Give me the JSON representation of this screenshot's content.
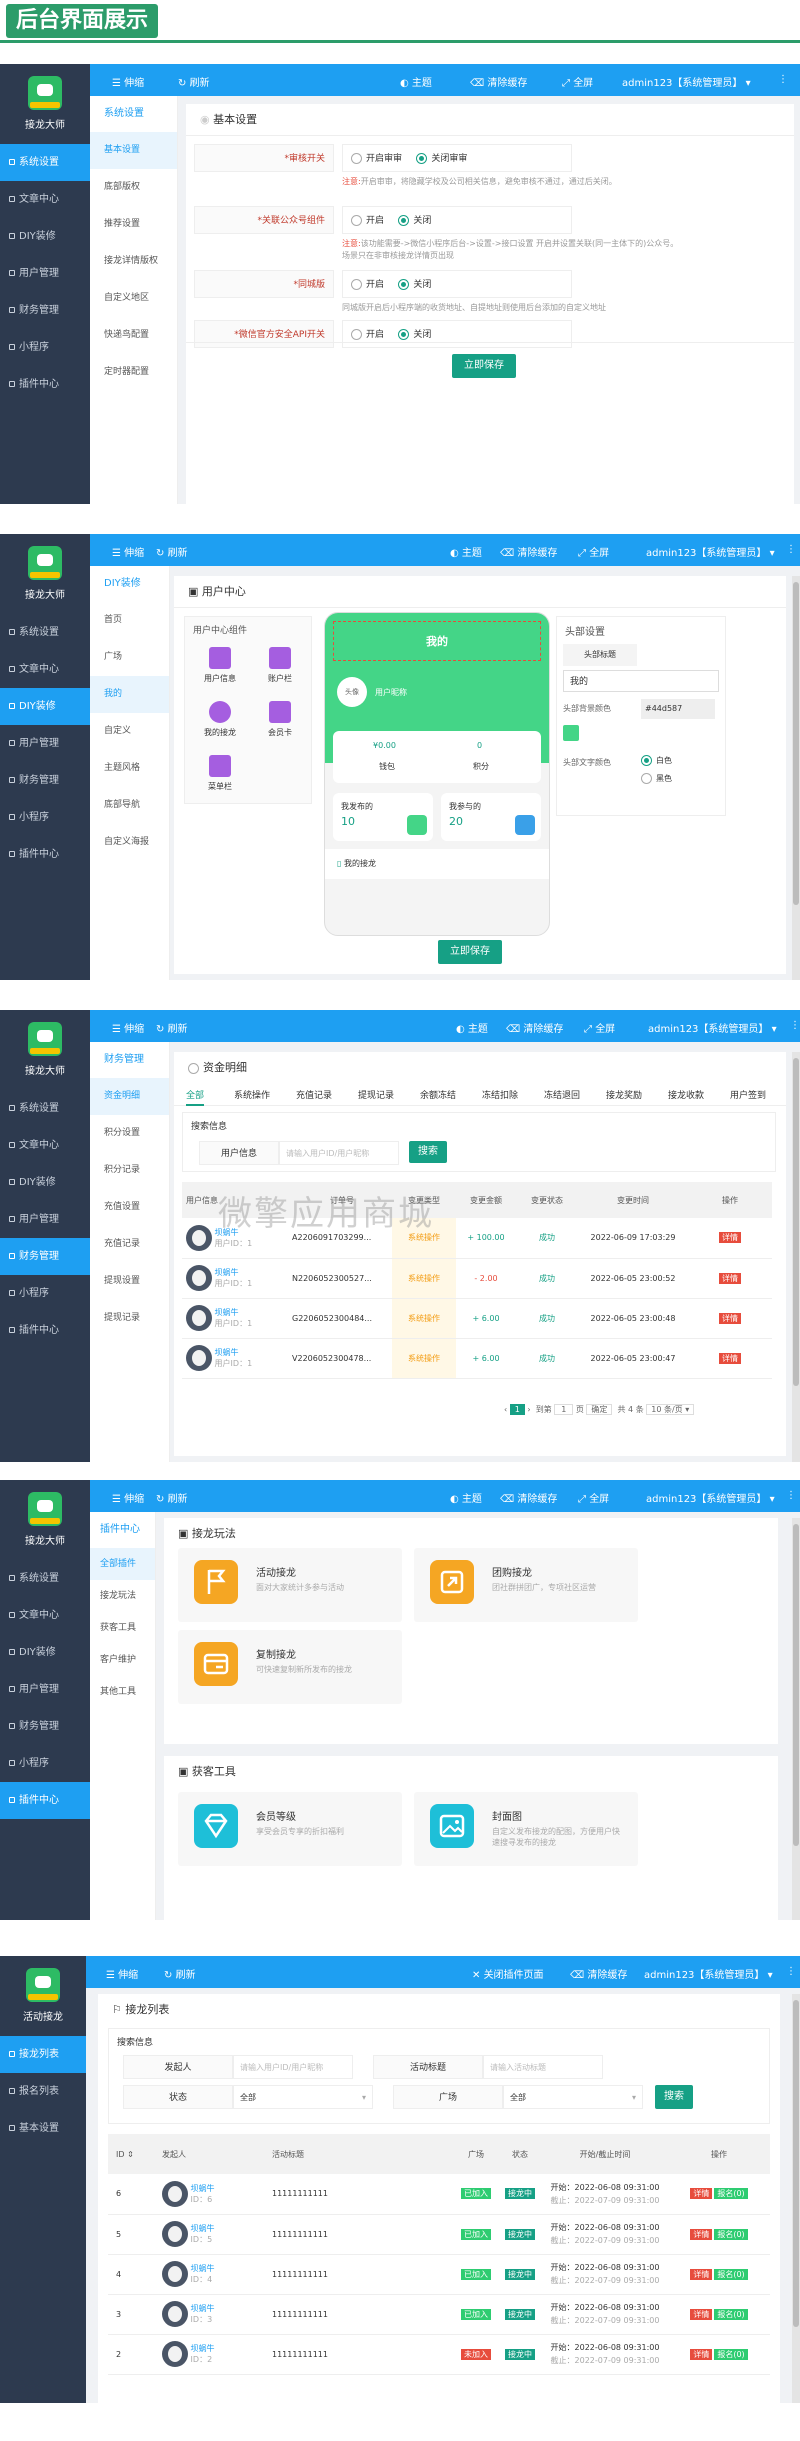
{
  "hero_title": "后台界面展示",
  "brand": "接龙大师",
  "brand2": "活动接龙",
  "topbar": {
    "collapse": "伸缩",
    "refresh": "刷新",
    "theme": "主题",
    "clear_cache": "清除缓存",
    "fullscreen": "全屏",
    "user": "admin123【系统管理员】",
    "close_plugin": "关闭插件页面"
  },
  "main_menu": [
    "系统设置",
    "文章中心",
    "DIY装修",
    "用户管理",
    "财务管理",
    "小程序",
    "插件中心"
  ],
  "s1": {
    "sub_head": "系统设置",
    "sub_items": [
      "基本设置",
      "底部版权",
      "推荐设置",
      "接龙详情版权",
      "自定义地区",
      "快递鸟配置",
      "定时器配置"
    ],
    "panel_title": "基本设置",
    "rows": [
      {
        "label": "*审核开关",
        "opt1": "开启审审",
        "opt2": "关闭审审",
        "note_label": "注意:",
        "note": "开启审审，将隐藏学校及公司相关信息，避免审核不通过，通过后关闭。"
      },
      {
        "label": "*关联公众号组件",
        "opt1": "开启",
        "opt2": "关闭",
        "note_label": "注意:",
        "note": "该功能需要->微信小程序后台->设置->接口设置 开启并设置关联(同一主体下的)公众号。",
        "note2": "场景只在非审核接龙详情页出现"
      },
      {
        "label": "*同城版",
        "opt1": "开启",
        "opt2": "关闭",
        "note": "同城版开启后小程序端的收货地址、自提地址则使用后台添加的自定义地址"
      },
      {
        "label": "*微信官方安全API开关",
        "opt1": "开启",
        "opt2": "关闭"
      }
    ],
    "save": "立即保存"
  },
  "s2": {
    "sub_head": "DIY装修",
    "sub_items": [
      "首页",
      "广场",
      "我的",
      "自定义",
      "主题风格",
      "底部导航",
      "自定义海报"
    ],
    "panel_title": "用户中心",
    "widgets_title": "用户中心组件",
    "widgets": [
      "用户信息",
      "账户栏",
      "我的接龙",
      "会员卡",
      "菜单栏"
    ],
    "phone": {
      "header": "我的",
      "avatar": "头像",
      "nickname": "用户昵称",
      "wallet_val": "¥0.00",
      "wallet": "钱包",
      "points_val": "0",
      "points": "积分",
      "pub": "我发布的",
      "pub_val": "10",
      "join": "我参与的",
      "join_val": "20",
      "my_jl": "我的接龙"
    },
    "cfg": {
      "title": "头部设置",
      "tab": "头部标题",
      "title_val": "我的",
      "bg_label": "头部背景颜色",
      "bg_val": "#44d587",
      "color_label": "头部文字颜色",
      "white": "白色",
      "black": "黑色"
    },
    "save": "立即保存"
  },
  "s3": {
    "sub_head": "财务管理",
    "sub_items": [
      "资金明细",
      "积分设置",
      "积分记录",
      "充值设置",
      "充值记录",
      "提现设置",
      "提现记录"
    ],
    "panel_title": "资金明细",
    "tabs": [
      "全部",
      "系统操作",
      "充值记录",
      "提现记录",
      "余额冻结",
      "冻结扣除",
      "冻结退回",
      "接龙奖励",
      "接龙收款",
      "用户签到"
    ],
    "search_title": "搜索信息",
    "user_label": "用户信息",
    "user_ph": "请输入用户ID/用户昵称",
    "search_btn": "搜索",
    "cols": [
      "用户信息",
      "订单号",
      "变更类型",
      "变更金额",
      "变更状态",
      "变更时间",
      "操作"
    ],
    "rows": [
      {
        "name": "坝蜗牛",
        "uid": "用户ID：1",
        "order": "A2206091703299...",
        "type": "系统操作",
        "amount": "+ 100.00",
        "status": "成功",
        "time": "2022-06-09 17:03:29",
        "op": "详情"
      },
      {
        "name": "坝蜗牛",
        "uid": "用户ID：1",
        "order": "N2206052300527...",
        "type": "系统操作",
        "amount": "- 2.00",
        "status": "成功",
        "time": "2022-06-05 23:00:52",
        "op": "详情"
      },
      {
        "name": "坝蜗牛",
        "uid": "用户ID：1",
        "order": "G2206052300484...",
        "type": "系统操作",
        "amount": "+ 6.00",
        "status": "成功",
        "time": "2022-06-05 23:00:48",
        "op": "详情"
      },
      {
        "name": "坝蜗牛",
        "uid": "用户ID：1",
        "order": "V2206052300478...",
        "type": "系统操作",
        "amount": "+ 6.00",
        "status": "成功",
        "time": "2022-06-05 23:00:47",
        "op": "详情"
      }
    ],
    "pager": {
      "page": "1",
      "goto": "到第",
      "page_input": "1",
      "page_unit": "页",
      "confirm": "确定",
      "total": "共 4 条",
      "per": "10 条/页"
    },
    "watermark": "微擎应用商城"
  },
  "s4": {
    "sub_head": "插件中心",
    "sub_items": [
      "全部插件",
      "接龙玩法",
      "获客工具",
      "客户维护",
      "其他工具"
    ],
    "sec1": "接龙玩法",
    "sec2": "获客工具",
    "cards1": [
      {
        "t": "活动接龙",
        "s": "面对大家统计多参与活动"
      },
      {
        "t": "团购接龙",
        "s": "团社群拼团广，专项社区运营"
      },
      {
        "t": "复制接龙",
        "s": "可快速复制新所发布的接龙"
      }
    ],
    "cards2": [
      {
        "t": "会员等级",
        "s": "享受会员专享的折扣福利"
      },
      {
        "t": "封面图",
        "s": "自定义发布接龙的配图，方便用户快速搜寻发布的接龙"
      }
    ]
  },
  "s5": {
    "sub_items": [
      "接龙列表",
      "报名列表",
      "基本设置"
    ],
    "panel_title": "接龙列表",
    "search_title": "搜索信息",
    "f_initiator": "发起人",
    "f_initiator_ph": "请输入用户ID/用户昵称",
    "f_title": "活动标题",
    "f_title_ph": "请输入活动标题",
    "f_status": "状态",
    "f_status_val": "全部",
    "f_square": "广场",
    "f_square_val": "全部",
    "search_btn": "搜索",
    "cols": [
      "ID",
      "发起人",
      "活动标题",
      "广场",
      "状态",
      "开始/截止时间",
      "操作"
    ],
    "rows": [
      {
        "id": "6",
        "name": "坝蜗牛",
        "uid": "ID：6",
        "title": "11111111111",
        "square": "已加入",
        "status": "接龙中",
        "start": "开始：2022-06-08 09:31:00",
        "end": "截止：2022-07-09 09:31:00"
      },
      {
        "id": "5",
        "name": "坝蜗牛",
        "uid": "ID：5",
        "title": "11111111111",
        "square": "已加入",
        "status": "接龙中",
        "start": "开始：2022-06-08 09:31:00",
        "end": "截止：2022-07-09 09:31:00"
      },
      {
        "id": "4",
        "name": "坝蜗牛",
        "uid": "ID：4",
        "title": "11111111111",
        "square": "已加入",
        "status": "接龙中",
        "start": "开始：2022-06-08 09:31:00",
        "end": "截止：2022-07-09 09:31:00"
      },
      {
        "id": "3",
        "name": "坝蜗牛",
        "uid": "ID：3",
        "title": "11111111111",
        "square": "已加入",
        "status": "接龙中",
        "start": "开始：2022-06-08 09:31:00",
        "end": "截止：2022-07-09 09:31:00"
      },
      {
        "id": "2",
        "name": "坝蜗牛",
        "uid": "ID：2",
        "title": "11111111111",
        "square": "未加入",
        "status": "接龙中",
        "start": "开始：2022-06-08 09:31:00",
        "end": "截止：2022-07-09 09:31:00"
      }
    ],
    "op1": "详情",
    "op2": "报名(0)"
  }
}
